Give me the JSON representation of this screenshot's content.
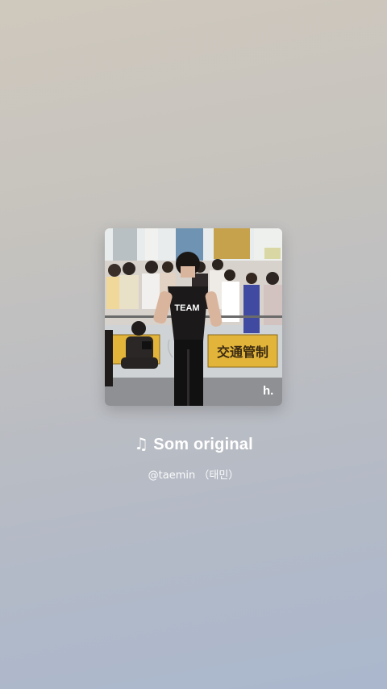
{
  "cover": {
    "sign_text": "交通管制",
    "shirt_text": "TEAM",
    "watermark": "h."
  },
  "track": {
    "note_icon": "music-note-icon",
    "title": "Som original"
  },
  "artist": {
    "handle": "@taemin （태민）"
  },
  "colors": {
    "background_top": "#cfc8bd",
    "background_bottom": "#aab7cd",
    "text": "#ffffff",
    "sign_yellow": "#e3b43a"
  }
}
